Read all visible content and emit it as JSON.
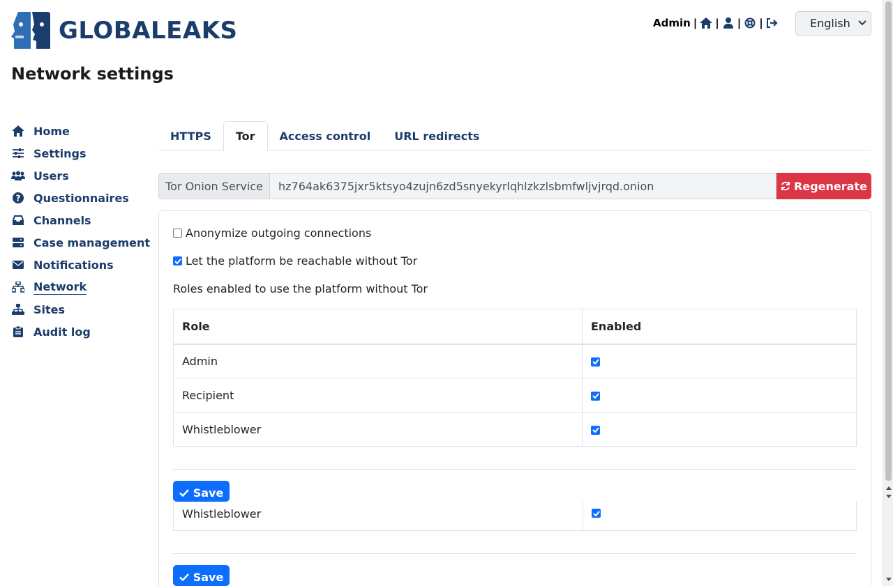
{
  "brand": {
    "name": "GLOBALEAKS",
    "color": "#1b3d6b"
  },
  "user_nav": {
    "user": "Admin",
    "separator": "|",
    "icons": [
      "home-icon",
      "user-icon",
      "support-icon",
      "logout-icon"
    ]
  },
  "language": {
    "selected": "English"
  },
  "page": {
    "title": "Network settings"
  },
  "sidebar": {
    "items": [
      {
        "label": "Home",
        "icon": "home-icon"
      },
      {
        "label": "Settings",
        "icon": "sliders-icon"
      },
      {
        "label": "Users",
        "icon": "users-icon"
      },
      {
        "label": "Questionnaires",
        "icon": "question-icon"
      },
      {
        "label": "Channels",
        "icon": "inbox-icon"
      },
      {
        "label": "Case management",
        "icon": "server-icon"
      },
      {
        "label": "Notifications",
        "icon": "envelope-icon"
      },
      {
        "label": "Network",
        "icon": "network-icon",
        "active": true
      },
      {
        "label": "Sites",
        "icon": "sitemap-icon"
      },
      {
        "label": "Audit log",
        "icon": "clipboard-icon"
      }
    ]
  },
  "tabs": [
    {
      "label": "HTTPS"
    },
    {
      "label": "Tor",
      "active": true
    },
    {
      "label": "Access control"
    },
    {
      "label": "URL redirects"
    }
  ],
  "onion": {
    "label": "Tor Onion Service",
    "value": "hz764ak6375jxr5ktsyo4zujn6zd5snyekyrlqhlzkzlsbmfwljvjrqd.onion",
    "regenerate_label": "Regenerate"
  },
  "options": {
    "anonymize_label": "Anonymize outgoing connections",
    "anonymize_checked": false,
    "reachable_label": "Let the platform be reachable without Tor",
    "reachable_checked": true,
    "roles_caption": "Roles enabled to use the platform without Tor"
  },
  "roles_table": {
    "headers": [
      "Role",
      "Enabled"
    ],
    "rows": [
      {
        "role": "Admin",
        "enabled": true
      },
      {
        "role": "Recipient",
        "enabled": true
      },
      {
        "role": "Whistleblower",
        "enabled": true
      }
    ]
  },
  "ghost_row": {
    "role": "Whistleblower",
    "enabled": true
  },
  "save_label": "Save",
  "colors": {
    "primary": "#0d6efd",
    "danger": "#dc3545",
    "nav": "#1b3d6b"
  }
}
